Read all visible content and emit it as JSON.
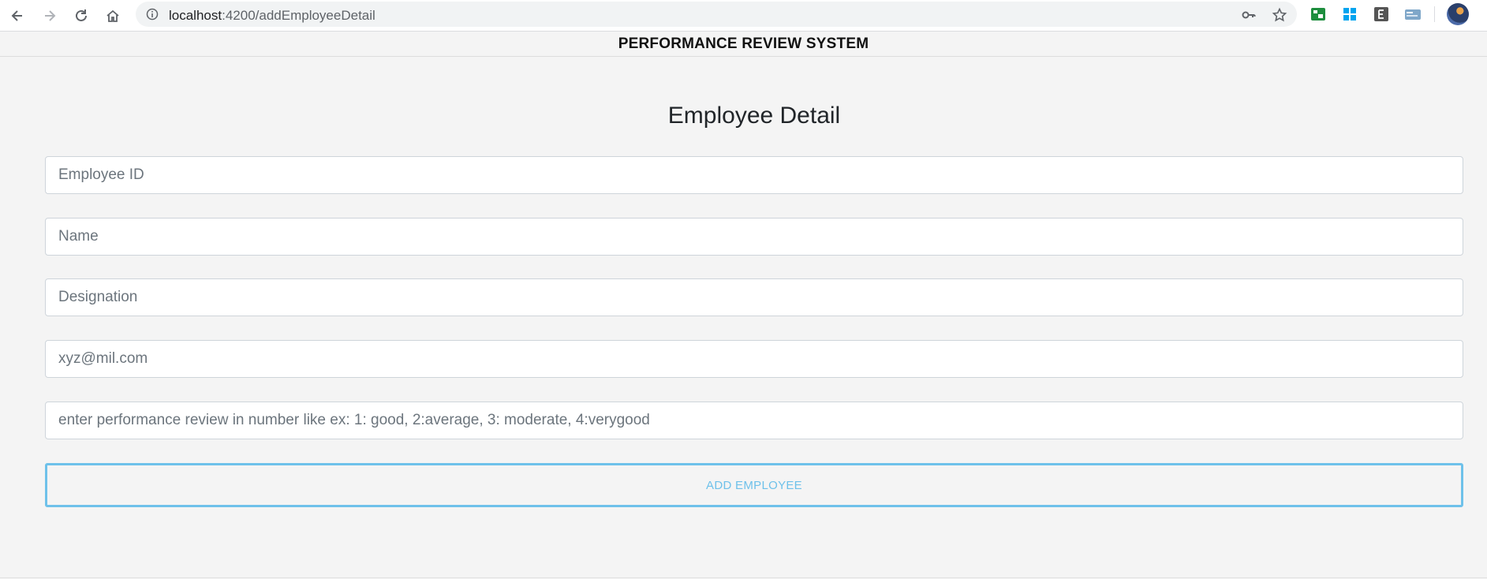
{
  "browser": {
    "url_host": "localhost",
    "url_path": ":4200/addEmployeeDetail"
  },
  "header": {
    "title": "PERFORMANCE REVIEW SYSTEM"
  },
  "form": {
    "title": "Employee Detail",
    "fields": [
      {
        "placeholder": "Employee ID",
        "value": ""
      },
      {
        "placeholder": "Name",
        "value": ""
      },
      {
        "placeholder": "Designation",
        "value": ""
      },
      {
        "placeholder": "xyz@mil.com",
        "value": ""
      },
      {
        "placeholder": "enter performance review in number like ex: 1: good, 2:average, 3: moderate, 4:verygood",
        "value": ""
      }
    ],
    "submit_label": "ADD EMPLOYEE"
  },
  "colors": {
    "accent": "#6ec1ea",
    "background": "#f4f4f4"
  },
  "icons": [
    "back-icon",
    "forward-icon",
    "reload-icon",
    "home-icon",
    "info-icon",
    "key-icon",
    "star-icon",
    "extension-green-icon",
    "windows-icon",
    "evernote-icon",
    "extension-card-icon",
    "avatar"
  ]
}
